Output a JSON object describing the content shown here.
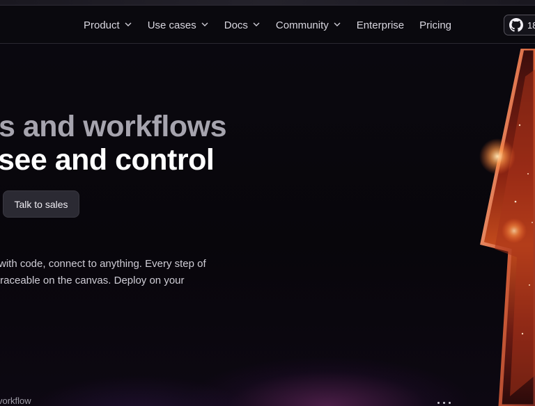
{
  "nav": {
    "items": [
      {
        "label": "Product",
        "dropdown": true
      },
      {
        "label": "Use cases",
        "dropdown": true
      },
      {
        "label": "Docs",
        "dropdown": true
      },
      {
        "label": "Community",
        "dropdown": true
      },
      {
        "label": "Enterprise",
        "dropdown": false
      },
      {
        "label": "Pricing",
        "dropdown": false
      }
    ],
    "github": {
      "icon": "github-icon",
      "count": "18"
    }
  },
  "hero": {
    "line1": "s and workflows",
    "line2": "see and control",
    "cta_secondary": "Talk to sales",
    "sub_line1": "with code, connect to anything. Every step of",
    "sub_line2": "traceable on the canvas. Deploy on your"
  },
  "footer": {
    "text": "vorkflow"
  },
  "colors": {
    "background": "#09070d",
    "button_bg": "#2b2a33",
    "headline_muted": "#a6a4ae",
    "headline_bright": "#ffffff",
    "accent_glow": "#e8552a"
  }
}
